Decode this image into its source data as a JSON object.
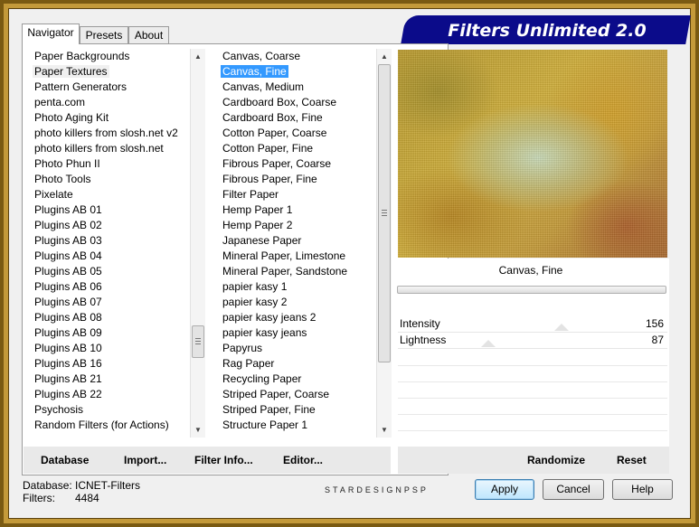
{
  "title": "Filters Unlimited 2.0",
  "tabs": [
    "Navigator",
    "Presets",
    "About"
  ],
  "categories": {
    "items": [
      "Paper Backgrounds",
      "Paper Textures",
      "Pattern Generators",
      "penta.com",
      "Photo Aging Kit",
      "photo killers from slosh.net v2",
      "photo killers from slosh.net",
      "Photo Phun II",
      "Photo Tools",
      "Pixelate",
      "Plugins AB 01",
      "Plugins AB 02",
      "Plugins AB 03",
      "Plugins AB 04",
      "Plugins AB 05",
      "Plugins AB 06",
      "Plugins AB 07",
      "Plugins AB 08",
      "Plugins AB 09",
      "Plugins AB 10",
      "Plugins AB 16",
      "Plugins AB 21",
      "Plugins AB 22",
      "Psychosis",
      "Random Filters (for Actions)"
    ],
    "selected": "Paper Textures"
  },
  "filters": {
    "items": [
      "Canvas, Coarse",
      "Canvas, Fine",
      "Canvas, Medium",
      "Cardboard Box, Coarse",
      "Cardboard Box, Fine",
      "Cotton Paper, Coarse",
      "Cotton Paper, Fine",
      "Fibrous Paper, Coarse",
      "Fibrous Paper, Fine",
      "Filter Paper",
      "Hemp Paper 1",
      "Hemp Paper 2",
      "Japanese Paper",
      "Mineral Paper, Limestone",
      "Mineral Paper, Sandstone",
      "papier kasy 1",
      "papier kasy 2",
      "papier kasy jeans 2",
      "papier kasy jeans",
      "Papyrus",
      "Rag Paper",
      "Recycling Paper",
      "Striped Paper, Coarse",
      "Striped Paper, Fine",
      "Structure Paper 1"
    ],
    "selected": "Canvas, Fine"
  },
  "preview": {
    "caption": "Canvas, Fine"
  },
  "params": [
    {
      "label": "Intensity",
      "value": "156"
    },
    {
      "label": "Lightness",
      "value": "87"
    }
  ],
  "left_buttons": {
    "database": "Database",
    "import": "Import...",
    "filter_info": "Filter Info...",
    "editor": "Editor..."
  },
  "right_buttons": {
    "randomize": "Randomize",
    "reset": "Reset"
  },
  "status": {
    "database_label": "Database:",
    "database_value": "ICNET-Filters",
    "filters_label": "Filters:",
    "filters_value": "4484"
  },
  "brand": "STARDESIGNPSP",
  "dialog_buttons": {
    "apply": "Apply",
    "cancel": "Cancel",
    "help": "Help"
  },
  "icons": {
    "scroll_up": "scroll-up-arrow-icon",
    "scroll_down": "scroll-down-arrow-icon"
  }
}
